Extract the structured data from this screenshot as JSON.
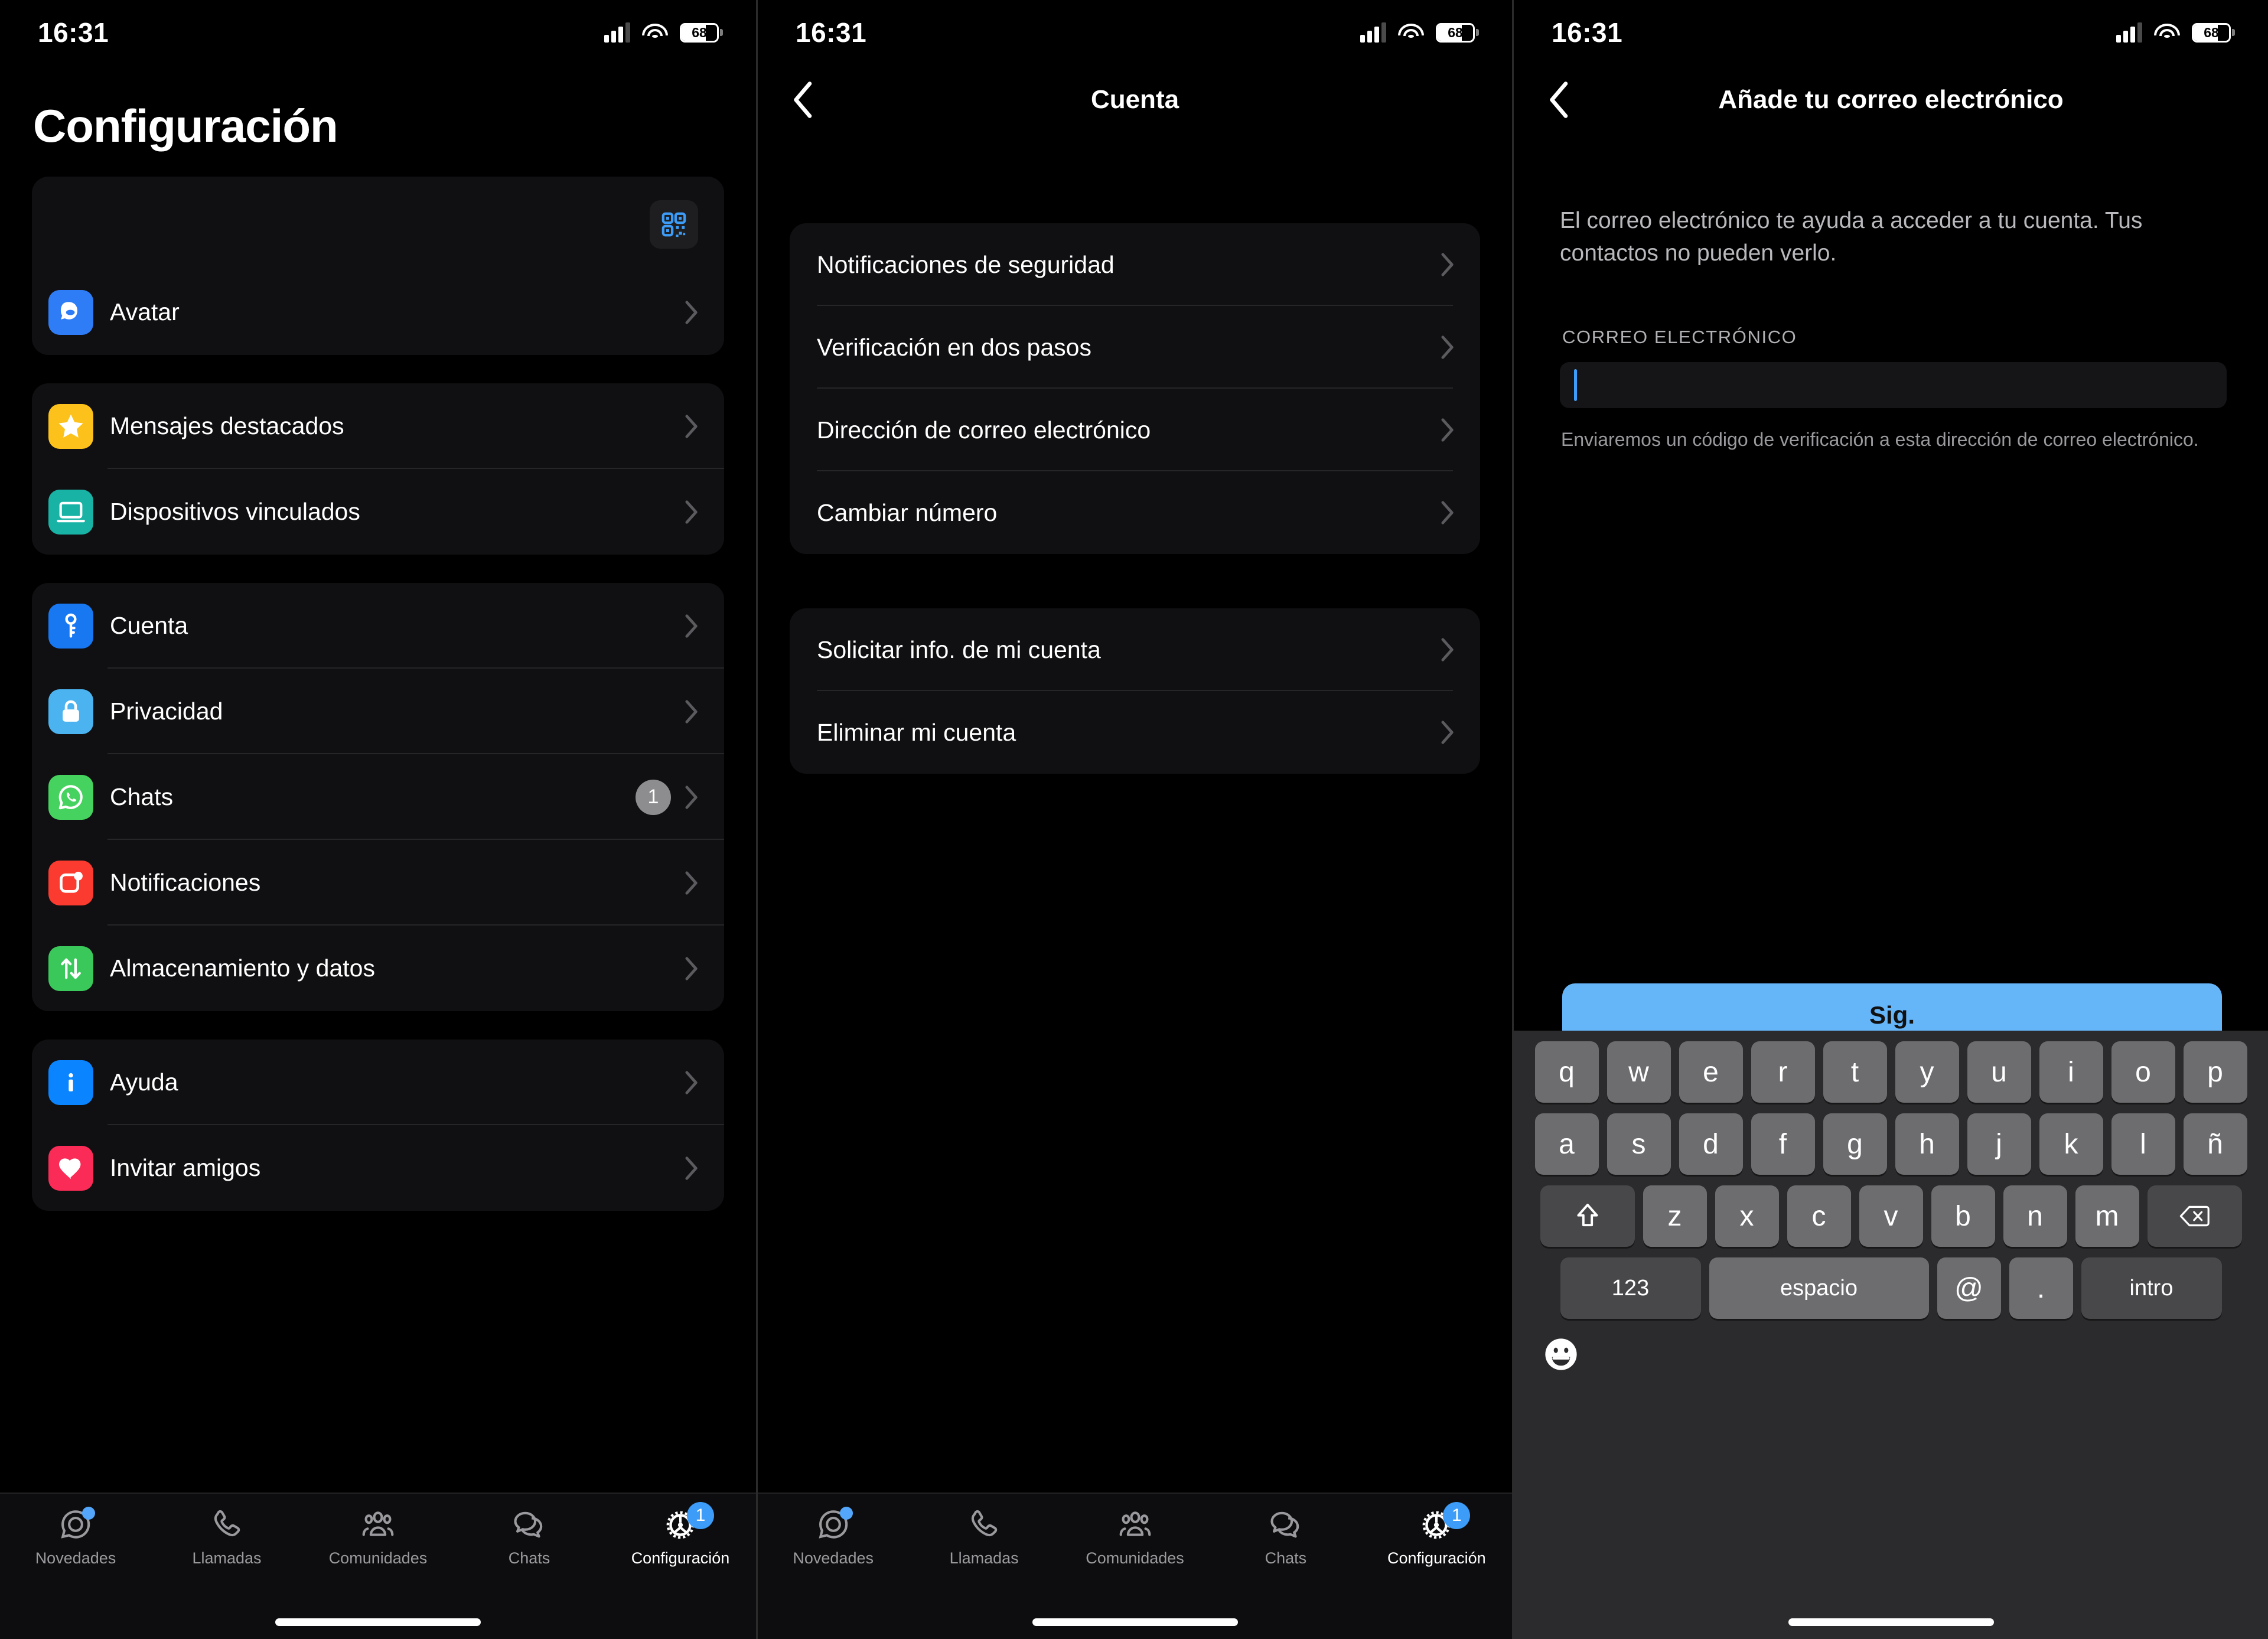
{
  "status_bar": {
    "time": "16:31",
    "battery": "68"
  },
  "panel1": {
    "title": "Configuración",
    "qr_icon": "qr-code-icon",
    "groups": [
      {
        "items": [
          {
            "label": "Avatar",
            "icon": "avatar-icon",
            "color": "#2f7df6",
            "badge": null
          }
        ]
      },
      {
        "items": [
          {
            "label": "Mensajes destacados",
            "icon": "star-icon",
            "color": "#fcc21b",
            "badge": null
          },
          {
            "label": "Dispositivos vinculados",
            "icon": "laptop-icon",
            "color": "#19b3a6",
            "badge": null
          }
        ]
      },
      {
        "items": [
          {
            "label": "Cuenta",
            "icon": "key-icon",
            "color": "#1878f2",
            "badge": null
          },
          {
            "label": "Privacidad",
            "icon": "lock-icon",
            "color": "#4bb4f0",
            "badge": null
          },
          {
            "label": "Chats",
            "icon": "whatsapp-icon",
            "color": "#46d25e",
            "badge": "1"
          },
          {
            "label": "Notificaciones",
            "icon": "notification-icon",
            "color": "#fc3b30",
            "badge": null
          },
          {
            "label": "Almacenamiento y datos",
            "icon": "arrows-updown-icon",
            "color": "#3ac85a",
            "badge": null
          }
        ]
      },
      {
        "items": [
          {
            "label": "Ayuda",
            "icon": "info-icon",
            "color": "#0a84ff",
            "badge": null
          },
          {
            "label": "Invitar amigos",
            "icon": "heart-icon",
            "color": "#fa2b56",
            "badge": null
          }
        ]
      }
    ]
  },
  "panel2": {
    "nav_title": "Cuenta",
    "back_icon": "chevron-left-icon",
    "groups": [
      {
        "items": [
          "Notificaciones de seguridad",
          "Verificación en dos pasos",
          "Dirección de correo electrónico",
          "Cambiar número"
        ]
      },
      {
        "items": [
          "Solicitar info. de mi cuenta",
          "Eliminar mi cuenta"
        ]
      }
    ]
  },
  "panel3": {
    "nav_title": "Añade tu correo electrónico",
    "back_icon": "chevron-left-icon",
    "description": "El correo electrónico te ayuda a acceder a tu cuenta. Tus contactos no pueden verlo.",
    "field_label": "CORREO ELECTRÓNICO",
    "field_value": "",
    "helper": "Enviaremos un código de verificación a esta dirección de correo electrónico.",
    "next_button": "Sig.",
    "keyboard": {
      "row1": [
        "q",
        "w",
        "e",
        "r",
        "t",
        "y",
        "u",
        "i",
        "o",
        "p"
      ],
      "row2": [
        "a",
        "s",
        "d",
        "f",
        "g",
        "h",
        "j",
        "k",
        "l",
        "ñ"
      ],
      "row3_shift": "shift-icon",
      "row3": [
        "z",
        "x",
        "c",
        "v",
        "b",
        "n",
        "m"
      ],
      "row3_backspace": "backspace-icon",
      "num_key": "123",
      "space_key": "espacio",
      "at_key": "@",
      "dot_key": ".",
      "enter_key": "intro",
      "emoji_key": "emoji-icon"
    }
  },
  "tabbar": {
    "tabs": [
      {
        "label": "Novedades",
        "icon": "updates-icon",
        "dot": true,
        "badge": null,
        "active": false
      },
      {
        "label": "Llamadas",
        "icon": "phone-icon",
        "dot": false,
        "badge": null,
        "active": false
      },
      {
        "label": "Comunidades",
        "icon": "communities-icon",
        "dot": false,
        "badge": null,
        "active": false
      },
      {
        "label": "Chats",
        "icon": "chats-icon",
        "dot": false,
        "badge": null,
        "active": false
      },
      {
        "label": "Configuración",
        "icon": "gear-icon",
        "dot": false,
        "badge": "1",
        "active": true
      }
    ]
  },
  "colors": {
    "accent": "#3c9cf7",
    "next_button": "#65b5f9",
    "card": "#101012"
  }
}
